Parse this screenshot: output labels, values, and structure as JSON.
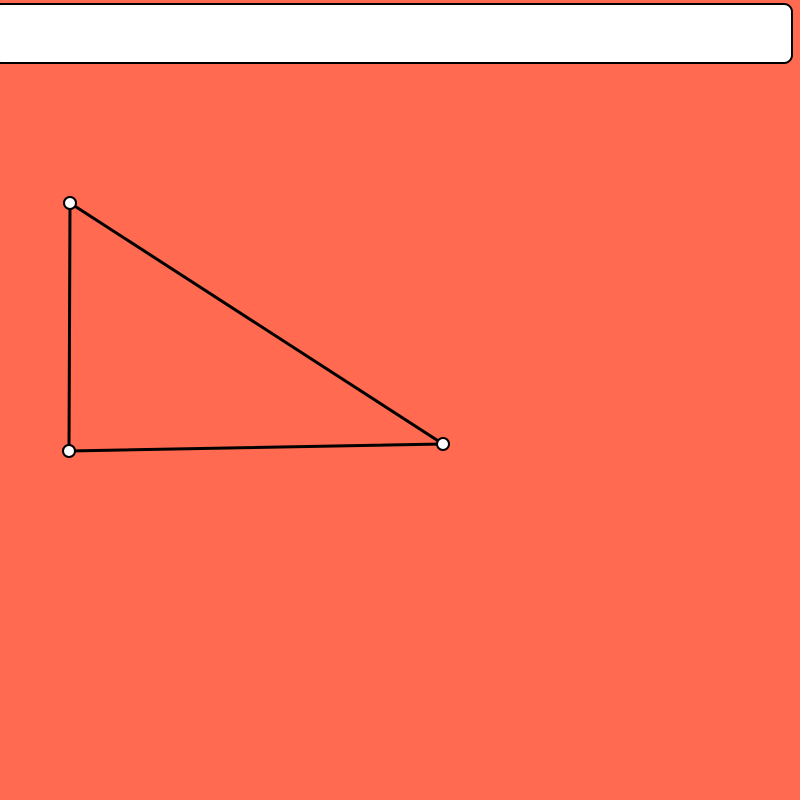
{
  "top_bar": {
    "text": ""
  },
  "colors": {
    "background": "#ff6a50",
    "bar_background": "#ffffff",
    "stroke": "#000000",
    "vertex_fill": "#ffffff"
  },
  "shape": {
    "type": "triangle",
    "vertex_icon": "circle-handle"
  }
}
